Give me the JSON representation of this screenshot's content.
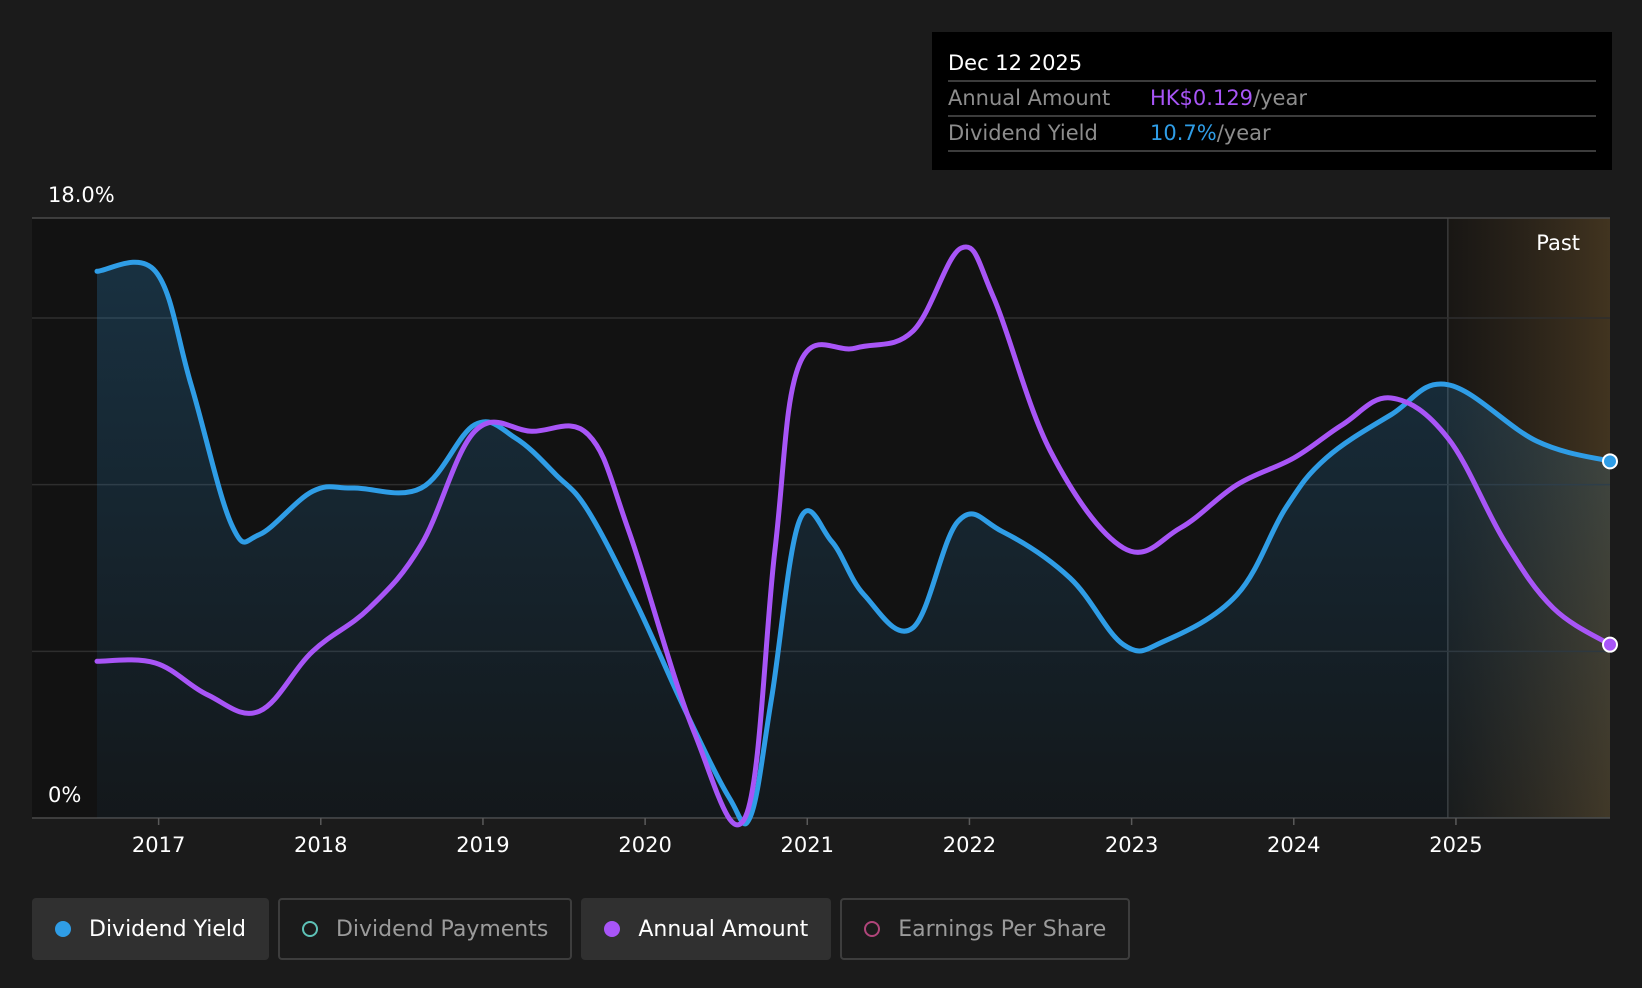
{
  "colors": {
    "background": "#1b1b1b",
    "dividend_yield": "#2f9de6",
    "annual_amount": "#a855f7",
    "dividend_payments": "#5ec2b7",
    "earnings_per_share": "#b0457a",
    "past_band": "#3d3020"
  },
  "tooltip": {
    "date": "Dec 12 2025",
    "annual_amount_label": "Annual Amount",
    "annual_amount_value": "HK$0.129",
    "annual_amount_unit": "/year",
    "dividend_yield_label": "Dividend Yield",
    "dividend_yield_value": "10.7%",
    "dividend_yield_unit": "/year"
  },
  "legend": [
    {
      "label": "Dividend Yield",
      "active": true,
      "icon": "filled-circle-icon"
    },
    {
      "label": "Dividend Payments",
      "active": false,
      "icon": "hollow-circle-icon"
    },
    {
      "label": "Annual Amount",
      "active": true,
      "icon": "filled-circle-icon"
    },
    {
      "label": "Earnings Per Share",
      "active": false,
      "icon": "hollow-circle-icon"
    }
  ],
  "chart_data": {
    "type": "line",
    "y_max_label": "18.0%",
    "y_min_label": "0%",
    "past_label": "Past",
    "ylim": [
      0,
      18
    ],
    "xlim": [
      2016.62,
      2025.95
    ],
    "past_start": 2024.95,
    "x_ticks": [
      "2017",
      "2018",
      "2019",
      "2020",
      "2021",
      "2022",
      "2023",
      "2024",
      "2025"
    ],
    "x_tick_values": [
      2017,
      2018,
      2019,
      2020,
      2021,
      2022,
      2023,
      2024,
      2025
    ],
    "grid": true,
    "gridline_values": [
      5,
      10,
      15
    ],
    "series": [
      {
        "name": "Dividend Yield",
        "key": "dividend_yield",
        "area": true,
        "points": [
          [
            2016.62,
            16.4
          ],
          [
            2016.98,
            16.4
          ],
          [
            2017.2,
            13.0
          ],
          [
            2017.45,
            8.8
          ],
          [
            2017.62,
            8.5
          ],
          [
            2017.95,
            9.8
          ],
          [
            2018.2,
            9.9
          ],
          [
            2018.62,
            9.9
          ],
          [
            2018.95,
            11.8
          ],
          [
            2019.2,
            11.4
          ],
          [
            2019.45,
            10.3
          ],
          [
            2019.65,
            9.2
          ],
          [
            2019.95,
            6.4
          ],
          [
            2020.25,
            3.2
          ],
          [
            2020.52,
            0.6
          ],
          [
            2020.65,
            0.05
          ],
          [
            2020.78,
            3.6
          ],
          [
            2020.95,
            8.9
          ],
          [
            2021.15,
            8.3
          ],
          [
            2021.35,
            6.7
          ],
          [
            2021.65,
            5.7
          ],
          [
            2021.93,
            8.9
          ],
          [
            2022.2,
            8.6
          ],
          [
            2022.62,
            7.2
          ],
          [
            2022.95,
            5.2
          ],
          [
            2023.2,
            5.3
          ],
          [
            2023.65,
            6.7
          ],
          [
            2023.95,
            9.3
          ],
          [
            2024.2,
            10.8
          ],
          [
            2024.6,
            12.1
          ],
          [
            2024.95,
            13.0
          ],
          [
            2025.5,
            11.3
          ],
          [
            2025.95,
            10.7
          ]
        ]
      },
      {
        "name": "Annual Amount",
        "key": "annual_amount",
        "area": false,
        "points": [
          [
            2016.62,
            4.7
          ],
          [
            2016.98,
            4.65
          ],
          [
            2017.3,
            3.7
          ],
          [
            2017.62,
            3.2
          ],
          [
            2017.95,
            5.0
          ],
          [
            2018.3,
            6.3
          ],
          [
            2018.62,
            8.2
          ],
          [
            2018.95,
            11.6
          ],
          [
            2019.3,
            11.6
          ],
          [
            2019.65,
            11.5
          ],
          [
            2019.9,
            8.6
          ],
          [
            2020.3,
            2.6
          ],
          [
            2020.62,
            0.05
          ],
          [
            2020.8,
            8.0
          ],
          [
            2020.95,
            13.6
          ],
          [
            2021.3,
            14.1
          ],
          [
            2021.65,
            14.6
          ],
          [
            2021.95,
            17.1
          ],
          [
            2022.15,
            15.6
          ],
          [
            2022.5,
            11.0
          ],
          [
            2022.95,
            8.1
          ],
          [
            2023.3,
            8.7
          ],
          [
            2023.65,
            10.0
          ],
          [
            2024.0,
            10.8
          ],
          [
            2024.3,
            11.8
          ],
          [
            2024.6,
            12.6
          ],
          [
            2024.95,
            11.4
          ],
          [
            2025.3,
            8.3
          ],
          [
            2025.6,
            6.3
          ],
          [
            2025.95,
            5.2
          ]
        ]
      }
    ]
  }
}
